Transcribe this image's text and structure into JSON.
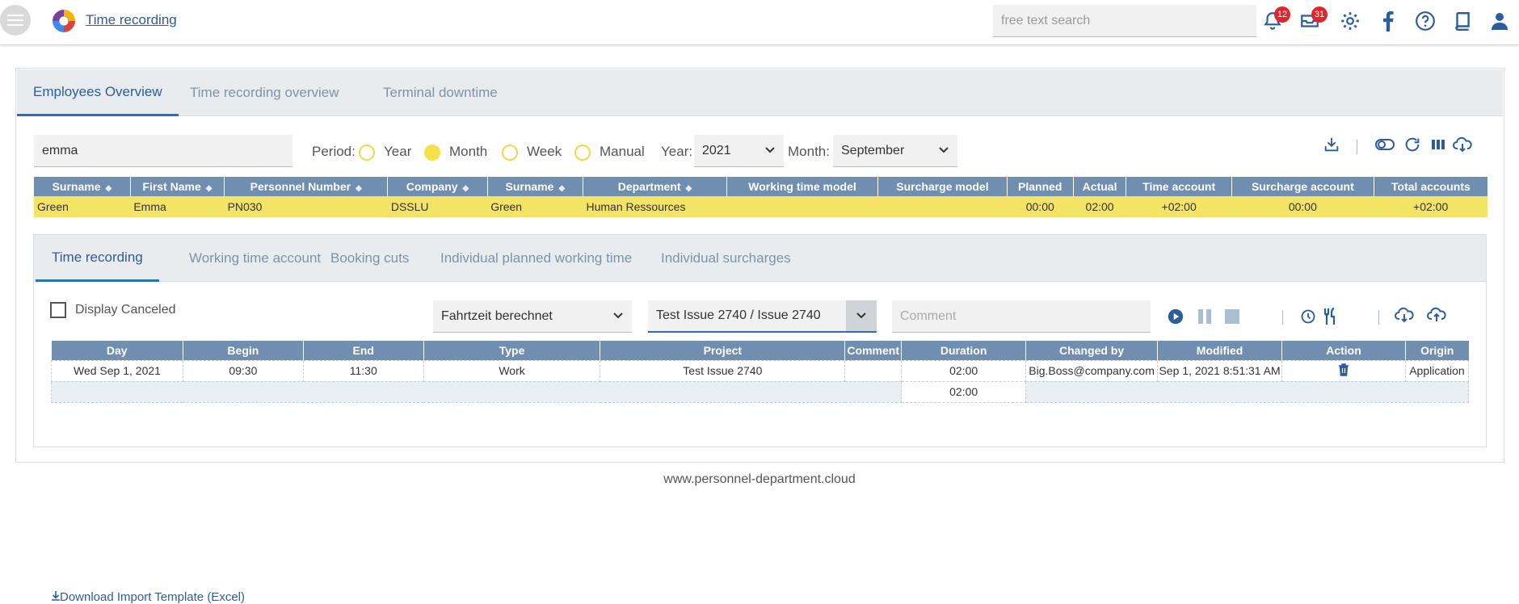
{
  "header": {
    "app_title": "Time recording",
    "search_placeholder": "free text search",
    "notifications_count": "12",
    "messages_count": "31"
  },
  "main_tabs": [
    "Employees Overview",
    "Time recording overview",
    "Terminal downtime"
  ],
  "filters": {
    "name_value": "emma",
    "period_label": "Period:",
    "period_options": [
      "Year",
      "Month",
      "Week",
      "Manual"
    ],
    "period_selected": "Month",
    "year_label": "Year:",
    "year_value": "2021",
    "month_label": "Month:",
    "month_value": "September"
  },
  "employee_table": {
    "columns": [
      "Surname",
      "First Name",
      "Personnel Number",
      "Company",
      "Surname",
      "Department",
      "Working time model",
      "Surcharge model",
      "Planned",
      "Actual",
      "Time account",
      "Surcharge account",
      "Total accounts"
    ],
    "rows": [
      [
        "Green",
        "Emma",
        "PN030",
        "DSSLU",
        "Green",
        "Human Ressources",
        "",
        "",
        "00:00",
        "02:00",
        "+02:00",
        "00:00",
        "+02:00"
      ]
    ]
  },
  "detail_tabs": [
    "Time recording",
    "Working time account",
    "Booking cuts",
    "Individual planned working time",
    "Individual surcharges"
  ],
  "recording": {
    "display_canceled_label": "Display Canceled",
    "type_value": "Fahrtzeit berechnet",
    "project_value": "Test Issue 2740 / Issue 2740",
    "comment_placeholder": "Comment"
  },
  "recording_table": {
    "columns": [
      "Day",
      "Begin",
      "End",
      "Type",
      "Project",
      "Comment",
      "Duration",
      "Changed by",
      "Modified",
      "Action",
      "Origin"
    ],
    "rows": [
      [
        "Wed Sep 1, 2021",
        "09:30",
        "11:30",
        "Work",
        "Test Issue 2740",
        "",
        "02:00",
        "Big.Boss@company.com",
        "Sep 1, 2021 8:51:31 AM",
        "",
        "Application"
      ]
    ],
    "total_duration": "02:00"
  },
  "download_link": "Download Import Template (Excel)",
  "footer": "www.personnel-department.cloud",
  "colors": {
    "accent": "#2b5d9c",
    "table_header": "#6f8eb0",
    "highlight_row": "#f4e465",
    "badge": "#e0262a"
  }
}
